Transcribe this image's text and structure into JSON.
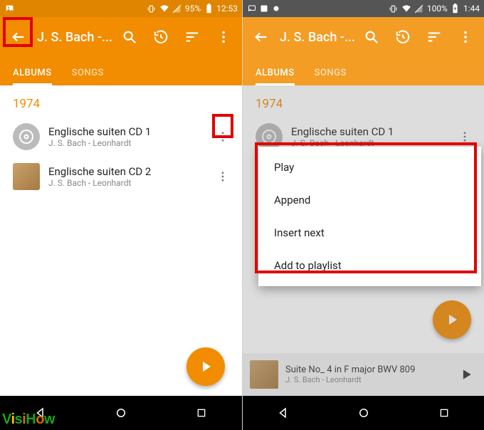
{
  "left": {
    "status": {
      "battery": "95%",
      "time": "12:53"
    },
    "title": "J. S. Bach -...",
    "tabs": {
      "albums": "ALBUMS",
      "songs": "SONGS"
    },
    "year": "1974",
    "albums": [
      {
        "title": "Englische suiten CD 1",
        "subtitle": "J. S. Bach - Leonhardt"
      },
      {
        "title": "Englische suiten CD 2",
        "subtitle": "J. S. Bach - Leonhardt"
      }
    ]
  },
  "right": {
    "status": {
      "battery": "100%",
      "time": "1:44"
    },
    "title": "J. S. Bach -...",
    "tabs": {
      "albums": "ALBUMS",
      "songs": "SONGS"
    },
    "year": "1974",
    "album": {
      "title": "Englische suiten CD 1",
      "subtitle": "J. S. Bach - Leonhardt"
    },
    "menu": {
      "play": "Play",
      "append": "Append",
      "insert": "Insert next",
      "add": "Add to playlist"
    },
    "now_playing": {
      "title": "Suite No_ 4 in F major BWV 809",
      "subtitle": "J. S. Bach - Leonhardt"
    }
  },
  "watermark": "VisiHow"
}
